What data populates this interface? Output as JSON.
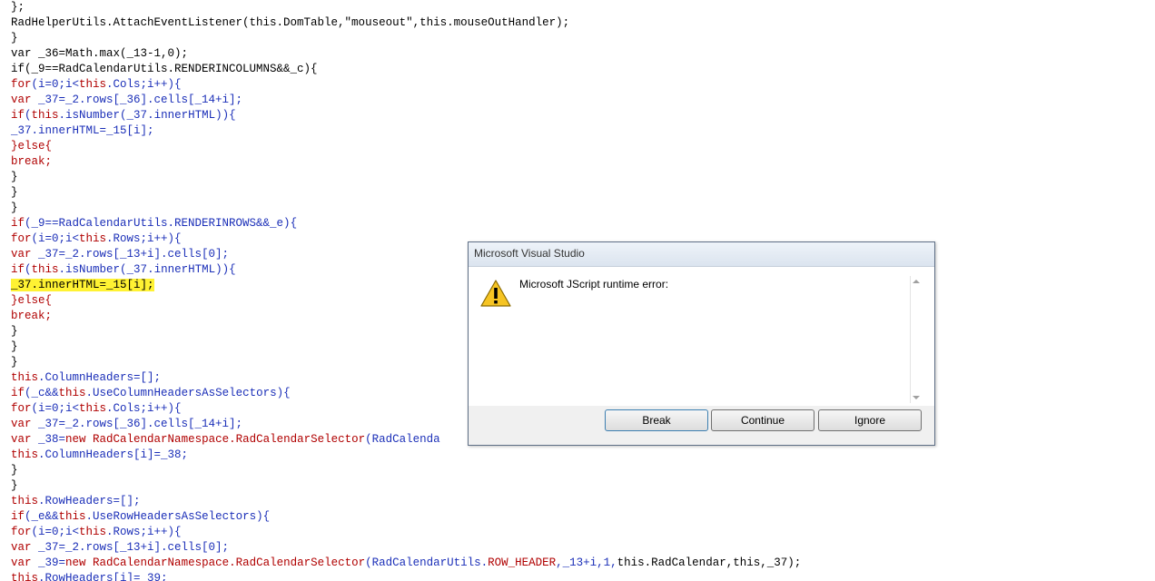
{
  "code_lines": [
    [
      [
        "p",
        "};"
      ]
    ],
    [
      [
        "n",
        "RadHelperUtils.AttachEventListener(this.DomTable,\"mouseout\",this.mouseOutHandler);"
      ]
    ],
    [
      [
        "p",
        "}"
      ]
    ],
    [
      [
        "n",
        "var _36=Math.max(_13-1,0);"
      ]
    ],
    [
      [
        "n",
        "if(_9==RadCalendarUtils.RENDERINCOLUMNS&&_c){"
      ]
    ],
    [
      [
        "r",
        "for"
      ],
      [
        "b",
        "(i=0;i<"
      ],
      [
        "r",
        "this"
      ],
      [
        "b",
        ".Cols;i++){"
      ]
    ],
    [
      [
        "r",
        "var "
      ],
      [
        "b",
        "_37=_2.rows[_36].cells[_14+i];"
      ]
    ],
    [
      [
        "r",
        "if"
      ],
      [
        "b",
        "("
      ],
      [
        "r",
        "this"
      ],
      [
        "b",
        ".isNumber(_37.innerHTML)){"
      ]
    ],
    [
      [
        "b",
        "_37.innerHTML=_15[i];"
      ]
    ],
    [
      [
        "r",
        "}else{"
      ]
    ],
    [
      [
        "r",
        "break;"
      ]
    ],
    [
      [
        "p",
        "}"
      ]
    ],
    [
      [
        "p",
        "}"
      ]
    ],
    [
      [
        "p",
        "}"
      ]
    ],
    [
      [
        "r",
        "if"
      ],
      [
        "b",
        "(_9==RadCalendarUtils.RENDERINROWS&&_e){"
      ]
    ],
    [
      [
        "r",
        "for"
      ],
      [
        "b",
        "(i=0;i<"
      ],
      [
        "r",
        "this"
      ],
      [
        "b",
        ".Rows;i++){"
      ]
    ],
    [
      [
        "r",
        "var "
      ],
      [
        "b",
        "_37=_2.rows[_13+i].cells[0];"
      ]
    ],
    [
      [
        "r",
        "if"
      ],
      [
        "b",
        "("
      ],
      [
        "r",
        "this"
      ],
      [
        "b",
        ".isNumber(_37.innerHTML)){"
      ]
    ],
    [
      [
        "hl",
        "_37.innerHTML=_15[i];"
      ]
    ],
    [
      [
        "r",
        "}else{"
      ]
    ],
    [
      [
        "r",
        "break;"
      ]
    ],
    [
      [
        "p",
        "}"
      ]
    ],
    [
      [
        "p",
        "}"
      ]
    ],
    [
      [
        "p",
        "}"
      ]
    ],
    [
      [
        "r",
        "this"
      ],
      [
        "b",
        ".ColumnHeaders=[];"
      ]
    ],
    [
      [
        "r",
        "if"
      ],
      [
        "b",
        "(_c&&"
      ],
      [
        "r",
        "this"
      ],
      [
        "b",
        ".UseColumnHeadersAsSelectors){"
      ]
    ],
    [
      [
        "r",
        "for"
      ],
      [
        "b",
        "(i=0;i<"
      ],
      [
        "r",
        "this"
      ],
      [
        "b",
        ".Cols;i++){"
      ]
    ],
    [
      [
        "r",
        "var "
      ],
      [
        "b",
        "_37=_2.rows[_36].cells[_14+i];"
      ]
    ],
    [
      [
        "r",
        "var "
      ],
      [
        "b",
        "_38="
      ],
      [
        "r",
        "new "
      ],
      [
        "r",
        "RadCalendarNamespace.RadCalendarSelector"
      ],
      [
        "b",
        "(RadCalenda"
      ]
    ],
    [
      [
        "r",
        "this"
      ],
      [
        "b",
        ".ColumnHeaders[i]=_38;"
      ]
    ],
    [
      [
        "p",
        "}"
      ]
    ],
    [
      [
        "p",
        "}"
      ]
    ],
    [
      [
        "r",
        "this"
      ],
      [
        "b",
        ".RowHeaders=[];"
      ]
    ],
    [
      [
        "r",
        "if"
      ],
      [
        "b",
        "(_e&&"
      ],
      [
        "r",
        "this"
      ],
      [
        "b",
        ".UseRowHeadersAsSelectors){"
      ]
    ],
    [
      [
        "r",
        "for"
      ],
      [
        "b",
        "(i=0;i<"
      ],
      [
        "r",
        "this"
      ],
      [
        "b",
        ".Rows;i++){"
      ]
    ],
    [
      [
        "r",
        "var "
      ],
      [
        "b",
        "_37=_2.rows[_13+i].cells[0];"
      ]
    ],
    [
      [
        "r",
        "var "
      ],
      [
        "b",
        "_39="
      ],
      [
        "r",
        "new "
      ],
      [
        "r",
        "RadCalendarNamespace.RadCalendarSelector"
      ],
      [
        "b",
        "(RadCalendarUtils."
      ],
      [
        "r",
        "ROW_HEADER"
      ],
      [
        "b",
        ",_13+i,1,"
      ],
      [
        "n",
        "this.RadCalendar,this,_37);"
      ]
    ],
    [
      [
        "r",
        "this"
      ],
      [
        "b",
        ".RowHeaders[i]=_39;"
      ]
    ]
  ],
  "colors": {
    "keyword_red": "#b00000",
    "identifier_blue": "#1b2fb8",
    "highlight_yellow": "#fff233"
  },
  "dialog": {
    "title": "Microsoft Visual Studio",
    "message": "Microsoft JScript runtime error:",
    "icon": "warning-icon",
    "buttons": {
      "break": "Break",
      "continue": "Continue",
      "ignore": "Ignore"
    }
  }
}
